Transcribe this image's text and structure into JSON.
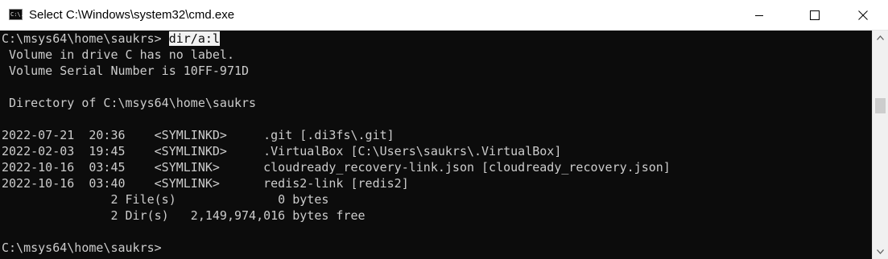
{
  "window": {
    "title": "Select C:\\Windows\\system32\\cmd.exe",
    "icon_text": "C:\\."
  },
  "console": {
    "prompt": "C:\\msys64\\home\\saukrs>",
    "command": "dir/a:l",
    "lines": [
      " Volume in drive C has no label.",
      " Volume Serial Number is 10FF-971D",
      "",
      " Directory of C:\\msys64\\home\\saukrs",
      "",
      "2022-07-21  20:36    <SYMLINKD>     .git [.di3fs\\.git]",
      "2022-02-03  19:45    <SYMLINKD>     .VirtualBox [C:\\Users\\saukrs\\.VirtualBox]",
      "2022-10-16  03:45    <SYMLINK>      cloudready_recovery-link.json [cloudready_recovery.json]",
      "2022-10-16  03:40    <SYMLINK>      redis2-link [redis2]",
      "               2 File(s)              0 bytes",
      "               2 Dir(s)   2,149,974,016 bytes free",
      "",
      "C:\\msys64\\home\\saukrs>"
    ]
  },
  "colors": {
    "console_bg": "#0c0c0c",
    "console_fg": "#cccccc",
    "selection_bg": "#f2f2f2"
  },
  "icons": [
    "cmd-app-icon",
    "minimize-icon",
    "maximize-icon",
    "close-icon",
    "chevron-up-icon",
    "chevron-down-icon"
  ]
}
